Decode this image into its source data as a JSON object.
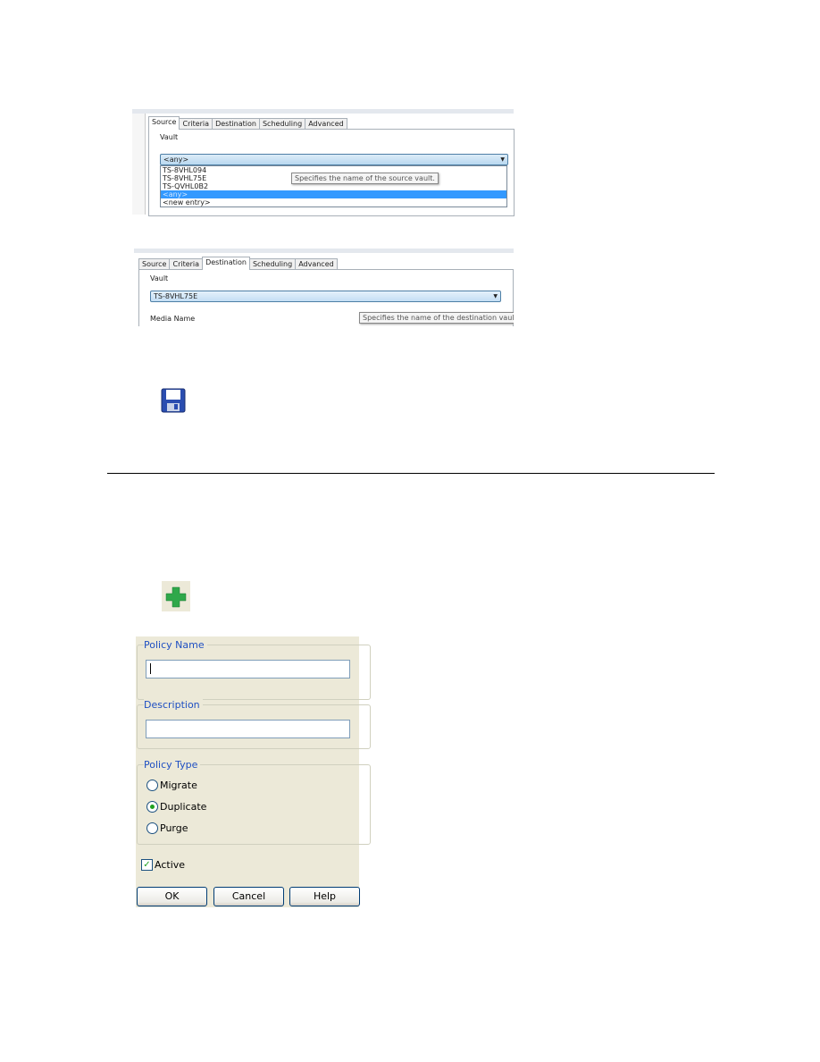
{
  "source_screenshot": {
    "tabs": [
      "Source",
      "Criteria",
      "Destination",
      "Scheduling",
      "Advanced"
    ],
    "active_tab": "Source",
    "group_label": "Vault",
    "combo_value": "<any>",
    "options": [
      "TS-8VHL094",
      "TS-8VHL75E",
      "TS-QVHL0B2",
      "<any>",
      "<new entry>"
    ],
    "selected_option": "<any>",
    "tooltip": "Specifies the name of the source vault."
  },
  "destination_screenshot": {
    "tabs": [
      "Source",
      "Criteria",
      "Destination",
      "Scheduling",
      "Advanced"
    ],
    "active_tab": "Destination",
    "group_label": "Vault",
    "combo_value": "TS-8VHL75E",
    "next_label": "Media Name",
    "tooltip": "Specifies the name of the destination vault."
  },
  "icons": {
    "save": "floppy-disk-icon",
    "add": "green-plus-icon"
  },
  "dialog": {
    "policy_name_label": "Policy Name",
    "policy_name_value": "",
    "description_label": "Description",
    "description_value": "",
    "policy_type_label": "Policy Type",
    "policy_types": [
      "Migrate",
      "Duplicate",
      "Purge"
    ],
    "selected_policy_type": "Duplicate",
    "active_label": "Active",
    "active_checked": true,
    "ok": "OK",
    "cancel": "Cancel",
    "help": "Help"
  }
}
